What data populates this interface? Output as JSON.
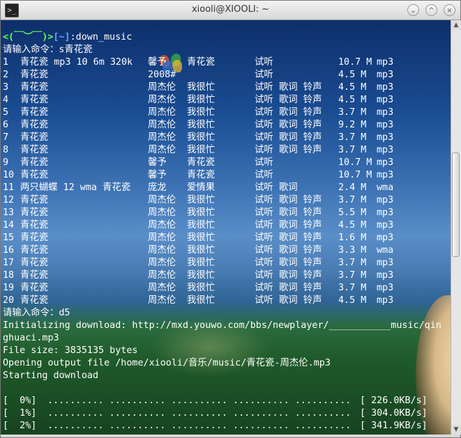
{
  "window": {
    "title": "xiooli@XIOOLI: ~",
    "app_icon": "terminal-icon",
    "buttons": {
      "collapse": "⌄",
      "restore": "^",
      "close": "×"
    }
  },
  "prompt": {
    "face": "<(￣︶￣)>",
    "path": "[~]",
    "command": ":down_music"
  },
  "input_line_1": "请输入命令：s青花瓷",
  "results": [
    {
      "no": "1",
      "title": "青花瓷 mp3 10 6m 320k",
      "artist": "馨予",
      "album": "青花瓷",
      "actions": "试听",
      "size": "10.7 M",
      "fmt": "mp3"
    },
    {
      "no": "2",
      "title": "青花瓷",
      "artist": "2008#",
      "album": "",
      "actions": "试听",
      "size": "4.5 M",
      "fmt": "mp3"
    },
    {
      "no": "3",
      "title": "青花瓷",
      "artist": "周杰伦",
      "album": "我很忙",
      "actions": "试听 歌词 铃声",
      "size": "4.5 M",
      "fmt": "mp3"
    },
    {
      "no": "4",
      "title": "青花瓷",
      "artist": "周杰伦",
      "album": "我很忙",
      "actions": "试听 歌词 铃声",
      "size": "4.5 M",
      "fmt": "mp3"
    },
    {
      "no": "5",
      "title": "青花瓷",
      "artist": "周杰伦",
      "album": "我很忙",
      "actions": "试听 歌词 铃声",
      "size": "3.7 M",
      "fmt": "mp3"
    },
    {
      "no": "6",
      "title": "青花瓷",
      "artist": "周杰伦",
      "album": "我很忙",
      "actions": "试听 歌词 铃声",
      "size": "9.2 M",
      "fmt": "mp3"
    },
    {
      "no": "7",
      "title": "青花瓷",
      "artist": "周杰伦",
      "album": "我很忙",
      "actions": "试听 歌词 铃声",
      "size": "3.7 M",
      "fmt": "mp3"
    },
    {
      "no": "8",
      "title": "青花瓷",
      "artist": "周杰伦",
      "album": "我很忙",
      "actions": "试听 歌词 铃声",
      "size": "3.7 M",
      "fmt": "mp3"
    },
    {
      "no": "9",
      "title": "青花瓷",
      "artist": "馨予",
      "album": "青花瓷",
      "actions": "试听",
      "size": "10.7 M",
      "fmt": "mp3"
    },
    {
      "no": "10",
      "title": "青花瓷",
      "artist": "馨予",
      "album": "青花瓷",
      "actions": "试听",
      "size": "10.7 M",
      "fmt": "mp3"
    },
    {
      "no": "11",
      "title": "两只蝴蝶 12 wma 青花瓷",
      "artist": "庞龙",
      "album": "爱情果",
      "actions": "试听 歌词",
      "size": "2.4 M",
      "fmt": "wma"
    },
    {
      "no": "12",
      "title": "青花瓷",
      "artist": "周杰伦",
      "album": "我很忙",
      "actions": "试听 歌词 铃声",
      "size": "3.7 M",
      "fmt": "mp3"
    },
    {
      "no": "13",
      "title": "青花瓷",
      "artist": "周杰伦",
      "album": "我很忙",
      "actions": "试听 歌词 铃声",
      "size": "5.5 M",
      "fmt": "mp3"
    },
    {
      "no": "14",
      "title": "青花瓷",
      "artist": "周杰伦",
      "album": "我很忙",
      "actions": "试听 歌词 铃声",
      "size": "4.5 M",
      "fmt": "mp3"
    },
    {
      "no": "15",
      "title": "青花瓷",
      "artist": "周杰伦",
      "album": "我很忙",
      "actions": "试听 歌词 铃声",
      "size": "1.6 M",
      "fmt": "mp3"
    },
    {
      "no": "16",
      "title": "青花瓷",
      "artist": "周杰伦",
      "album": "我很忙",
      "actions": "试听 歌词 铃声",
      "size": "3.3 M",
      "fmt": "wma"
    },
    {
      "no": "17",
      "title": "青花瓷",
      "artist": "周杰伦",
      "album": "我很忙",
      "actions": "试听 歌词 铃声",
      "size": "3.7 M",
      "fmt": "mp3"
    },
    {
      "no": "18",
      "title": "青花瓷",
      "artist": "周杰伦",
      "album": "我很忙",
      "actions": "试听 歌词 铃声",
      "size": "3.7 M",
      "fmt": "mp3"
    },
    {
      "no": "19",
      "title": "青花瓷",
      "artist": "周杰伦",
      "album": "我很忙",
      "actions": "试听 歌词 铃声",
      "size": "3.7 M",
      "fmt": "mp3"
    },
    {
      "no": "20",
      "title": "青花瓷",
      "artist": "周杰伦",
      "album": "我很忙",
      "actions": "试听 歌词 铃声",
      "size": "4.5 M",
      "fmt": "mp3"
    }
  ],
  "input_line_2": "请输入命令：d5",
  "download_log": [
    "Initializing download: http://mxd.youwo.com/bbs/newplayer/___________music/qin",
    "ghuaci.mp3",
    "File size: 3835135 bytes",
    "Opening output file /home/xiooli/音乐/music/青花瓷-周杰伦.mp3",
    "Starting download",
    ""
  ],
  "progress": [
    {
      "pct": "[  0%]",
      "dots": ".......... .......... .......... .......... ..........",
      "rate": "[ 226.0KB/s]"
    },
    {
      "pct": "[  1%]",
      "dots": ".......... .......... .......... .......... ..........",
      "rate": "[ 304.0KB/s]"
    },
    {
      "pct": "[  2%]",
      "dots": ".......... .......... .......... .......... ..........",
      "rate": "[ 341.9KB/s]"
    }
  ],
  "scrollbar": {
    "up": "▲",
    "down": "▼"
  }
}
